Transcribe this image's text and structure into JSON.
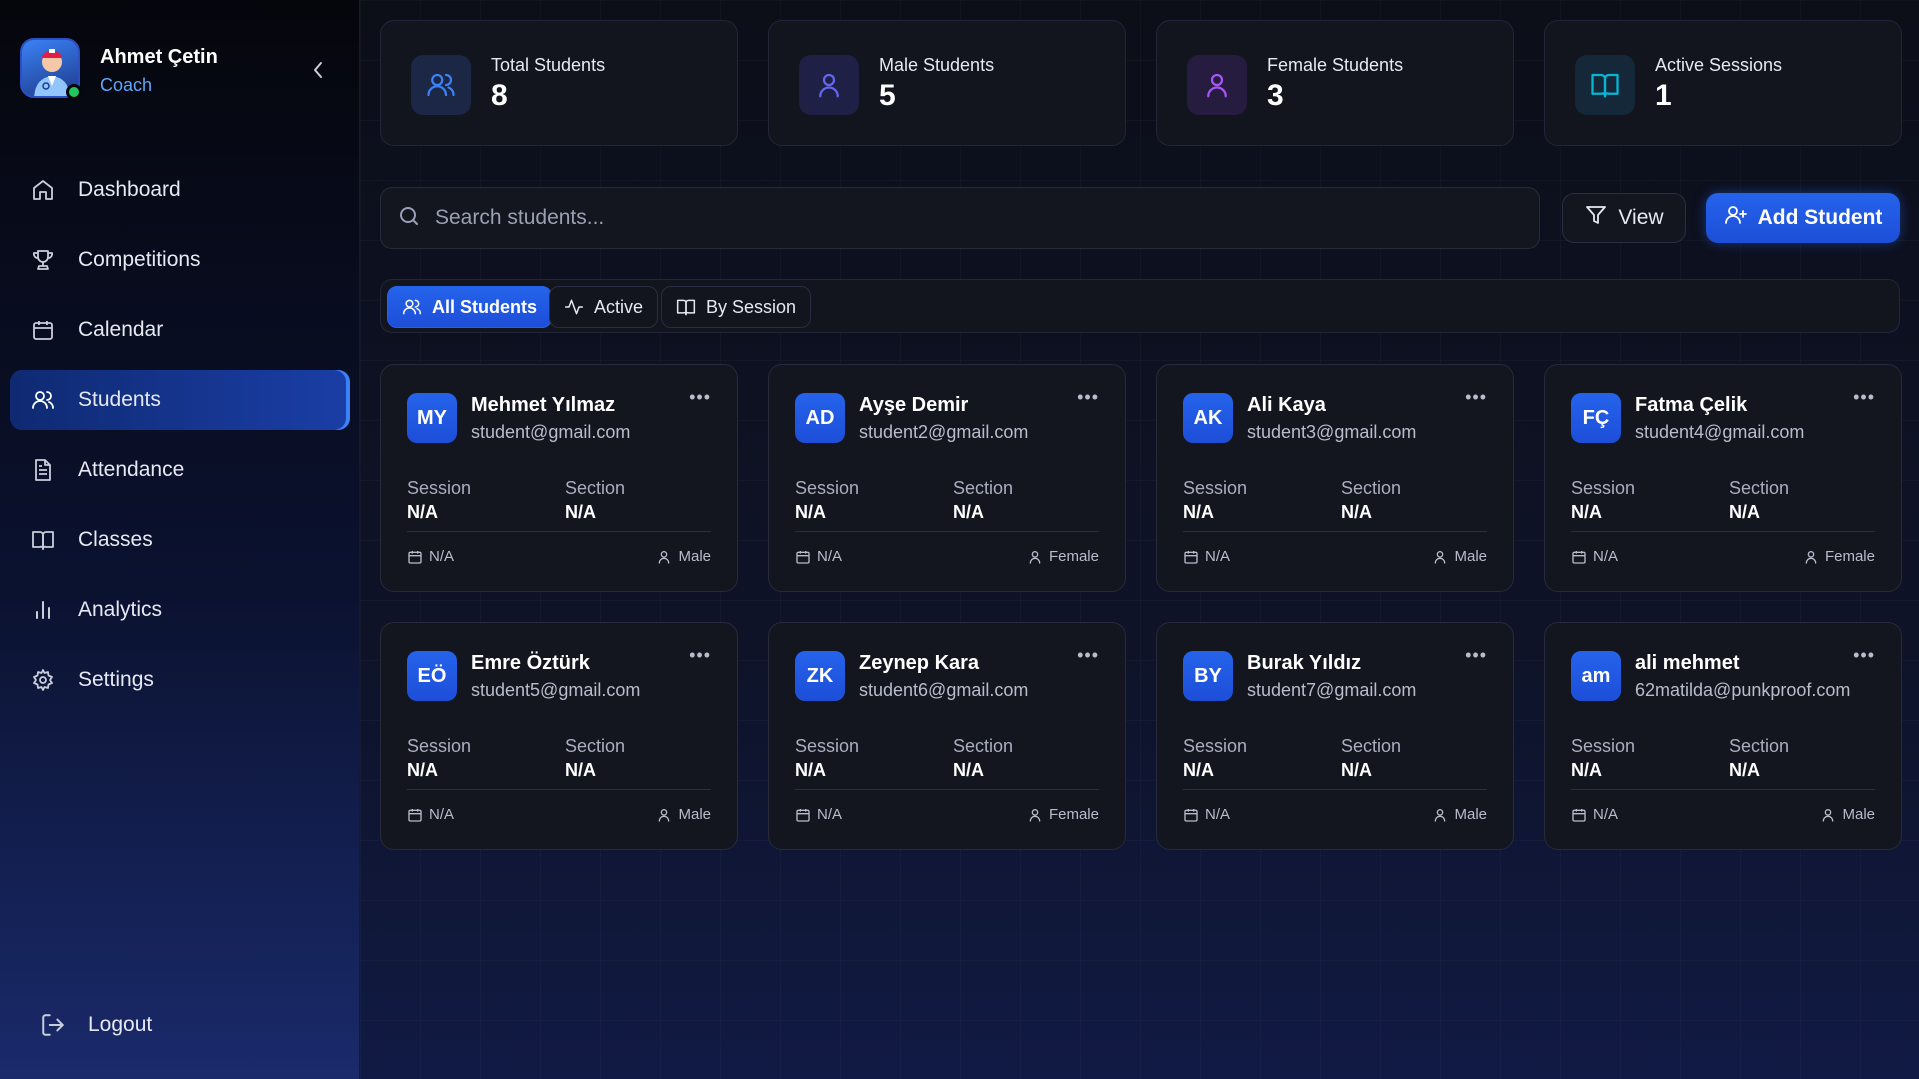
{
  "profile": {
    "name": "Ahmet Çetin",
    "role": "Coach"
  },
  "nav": {
    "items": [
      {
        "label": "Dashboard",
        "icon": "home-icon"
      },
      {
        "label": "Competitions",
        "icon": "trophy-icon"
      },
      {
        "label": "Calendar",
        "icon": "calendar-icon"
      },
      {
        "label": "Students",
        "icon": "users-icon",
        "active": true
      },
      {
        "label": "Attendance",
        "icon": "file-text-icon"
      },
      {
        "label": "Classes",
        "icon": "book-open-icon"
      },
      {
        "label": "Analytics",
        "icon": "bar-chart-icon"
      },
      {
        "label": "Settings",
        "icon": "gear-icon"
      }
    ],
    "logout": "Logout"
  },
  "stats": [
    {
      "label": "Total Students",
      "value": "8",
      "color": "#3b82f6",
      "icon": "users-icon"
    },
    {
      "label": "Male Students",
      "value": "5",
      "color": "#6366f1",
      "icon": "user-icon"
    },
    {
      "label": "Female Students",
      "value": "3",
      "color": "#a855f7",
      "icon": "user-icon"
    },
    {
      "label": "Active Sessions",
      "value": "1",
      "color": "#06b6d4",
      "icon": "book-open-icon"
    }
  ],
  "search": {
    "placeholder": "Search students..."
  },
  "toolbar": {
    "view_label": "View",
    "add_label": "Add Student"
  },
  "tabs": [
    {
      "label": "All Students",
      "active": true
    },
    {
      "label": "Active"
    },
    {
      "label": "By Session"
    }
  ],
  "card_labels": {
    "session": "Session",
    "section": "Section"
  },
  "students": [
    {
      "initials": "MY",
      "name": "Mehmet Yılmaz",
      "email": "student@gmail.com",
      "session": "N/A",
      "section": "N/A",
      "date": "N/A",
      "gender": "Male"
    },
    {
      "initials": "AD",
      "name": "Ayşe Demir",
      "email": "student2@gmail.com",
      "session": "N/A",
      "section": "N/A",
      "date": "N/A",
      "gender": "Female"
    },
    {
      "initials": "AK",
      "name": "Ali Kaya",
      "email": "student3@gmail.com",
      "session": "N/A",
      "section": "N/A",
      "date": "N/A",
      "gender": "Male"
    },
    {
      "initials": "FÇ",
      "name": "Fatma Çelik",
      "email": "student4@gmail.com",
      "session": "N/A",
      "section": "N/A",
      "date": "N/A",
      "gender": "Female"
    },
    {
      "initials": "EÖ",
      "name": "Emre Öztürk",
      "email": "student5@gmail.com",
      "session": "N/A",
      "section": "N/A",
      "date": "N/A",
      "gender": "Male"
    },
    {
      "initials": "ZK",
      "name": "Zeynep Kara",
      "email": "student6@gmail.com",
      "session": "N/A",
      "section": "N/A",
      "date": "N/A",
      "gender": "Female"
    },
    {
      "initials": "BY",
      "name": "Burak Yıldız",
      "email": "student7@gmail.com",
      "session": "N/A",
      "section": "N/A",
      "date": "N/A",
      "gender": "Male"
    },
    {
      "initials": "am",
      "name": "ali mehmet",
      "email": "62matilda@punkproof.com",
      "session": "N/A",
      "section": "N/A",
      "date": "N/A",
      "gender": "Male"
    }
  ]
}
